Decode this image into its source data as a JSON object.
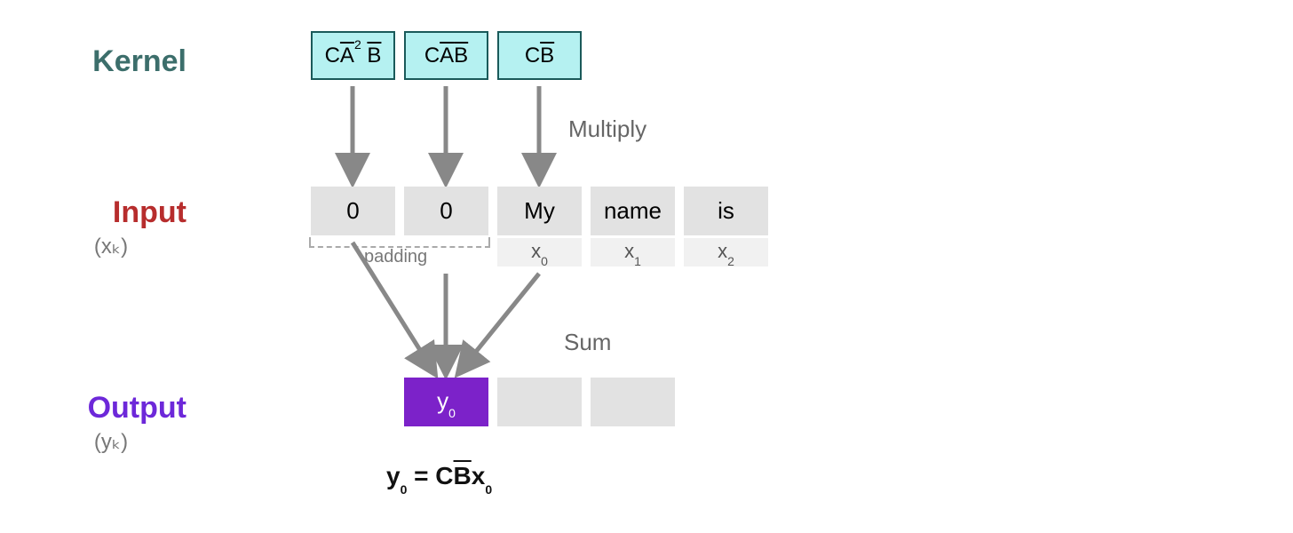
{
  "labels": {
    "kernel": "Kernel",
    "input": "Input",
    "input_sub": "(xₖ)",
    "output": "Output",
    "output_sub": "(yₖ)"
  },
  "kernel": {
    "box0": {
      "c": "C",
      "a": "A",
      "exp": "2",
      "b": "B"
    },
    "box1": {
      "c": "C",
      "a": "A",
      "b": "B"
    },
    "box2": {
      "c": "C",
      "b": "B"
    }
  },
  "ops": {
    "multiply": "Multiply",
    "sum": "Sum"
  },
  "inputs": {
    "pad0": "0",
    "pad1": "0",
    "x0_word": "My",
    "x1_word": "name",
    "x2_word": "is",
    "x0_sym": "x",
    "x0_sub": "0",
    "x1_sym": "x",
    "x1_sub": "1",
    "x2_sym": "x",
    "x2_sub": "2",
    "padding_label": "padding"
  },
  "outputs": {
    "y0_sym": "y",
    "y0_sub": "0"
  },
  "equation": {
    "lhs_y": "y",
    "lhs_sub": "0",
    "eq": " = ",
    "c": "C",
    "b": "B",
    "x": "x",
    "x_sub": "0"
  }
}
